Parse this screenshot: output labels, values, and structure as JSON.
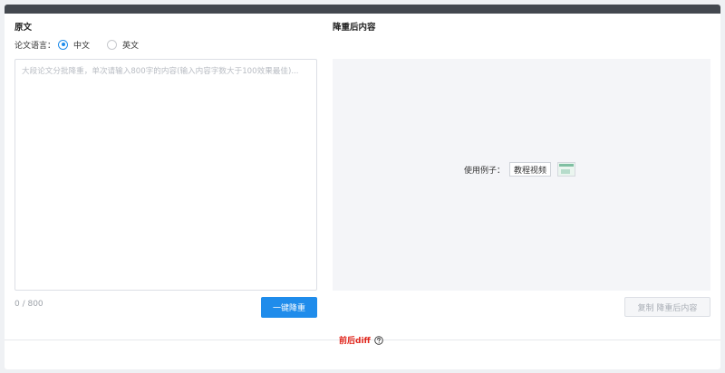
{
  "left": {
    "title": "原文",
    "language_label": "论文语言：",
    "language_options": [
      {
        "label": "中文",
        "checked": true
      },
      {
        "label": "英文",
        "checked": false
      }
    ],
    "textarea_placeholder": "大段论文分批降重，单次请输入800字的内容(输入内容字数大于100效果最佳)...",
    "textarea_value": "",
    "counter": "0 / 800",
    "submit_label": "一键降重"
  },
  "right": {
    "title": "降重后内容",
    "example_label": "使用例子：",
    "example_chip": "教程视频",
    "copy_label": "复制 降重后内容"
  },
  "footer": {
    "diff_label": "前后diff"
  },
  "colors": {
    "accent": "#1f8ceb",
    "top_bar": "#43484f",
    "diff_red": "#e1251b",
    "panel_bg": "#f4f5f8"
  },
  "icons": {
    "help": "question-circle-icon",
    "thumbnail": "video-thumbnail-icon"
  }
}
